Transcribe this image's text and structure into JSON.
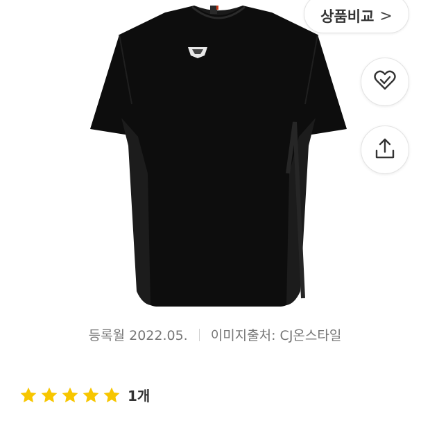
{
  "product": {
    "image_icon": "tshirt-image"
  },
  "actions": {
    "compare_label": "상품비교",
    "compare_chevron": ">",
    "wish_icon": "heart-check-icon",
    "share_icon": "share-icon"
  },
  "meta": {
    "registered": "등록월 2022.05.",
    "image_source": "이미지출처: CJ온스타일"
  },
  "rating": {
    "stars": 5,
    "max_stars": 5,
    "count_label": "1개",
    "star_color": "#F7C600"
  }
}
